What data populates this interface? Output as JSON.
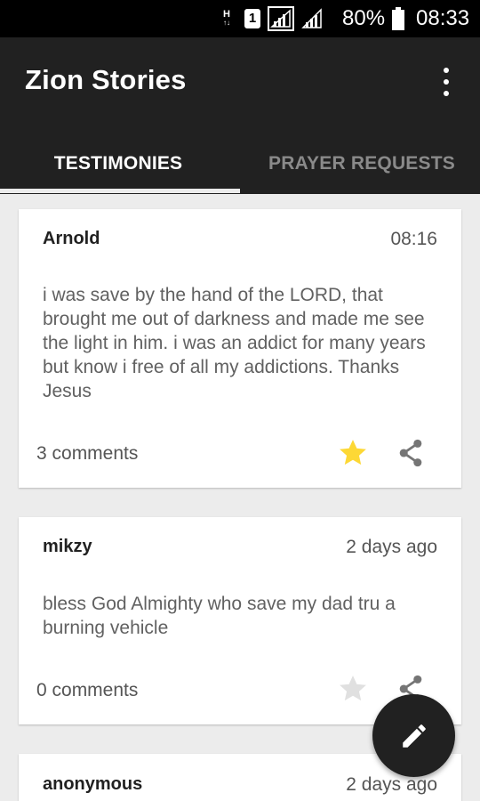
{
  "status_bar": {
    "network_h": "H",
    "network_h_sub": "↑↓",
    "sim_slot": "1",
    "battery_percent": "80%",
    "time": "08:33"
  },
  "app_bar": {
    "title": "Zion Stories",
    "overflow_icon": "more-vert-icon"
  },
  "tabs": [
    {
      "label": "TESTIMONIES",
      "selected": true
    },
    {
      "label": "PRAYER REQUESTS",
      "selected": false
    }
  ],
  "posts": [
    {
      "author": "Arnold",
      "time": "08:16",
      "body": "i was save by the hand of the LORD, that brought me out of darkness and made me see the light in him. i was an addict for many years but know i free of all my addictions. Thanks Jesus",
      "comments": "3 comments",
      "starred": true
    },
    {
      "author": "mikzy",
      "time": "2 days ago",
      "body": "bless God Almighty who save my dad tru a burning vehicle",
      "comments": "0 comments",
      "starred": false
    },
    {
      "author": "anonymous",
      "time": "2 days ago"
    }
  ],
  "colors": {
    "app_bar": "#212121",
    "star_active": "#fdd835",
    "star_inactive": "#e0e0e0",
    "background": "#ececec"
  },
  "fab": {
    "icon": "edit-pencil-icon"
  }
}
